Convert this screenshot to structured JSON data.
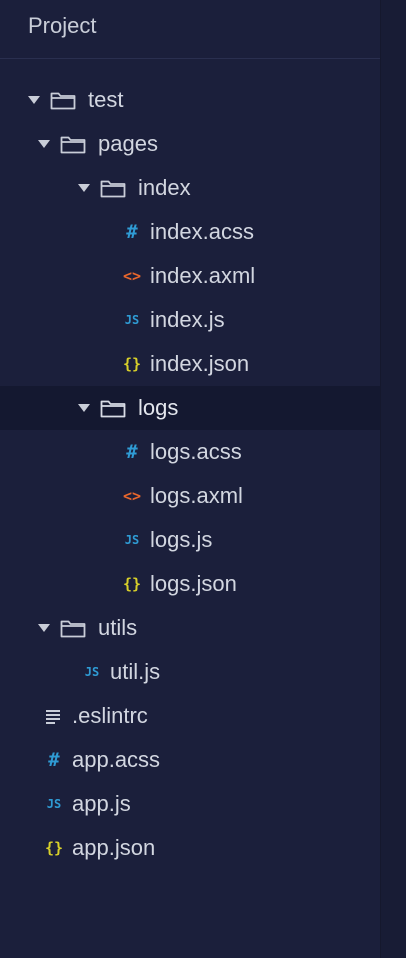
{
  "header": {
    "title": "Project"
  },
  "tree": {
    "test": {
      "label": "test",
      "pages": {
        "label": "pages",
        "index": {
          "label": "index",
          "files": [
            "index.acss",
            "index.axml",
            "index.js",
            "index.json"
          ]
        },
        "logs": {
          "label": "logs",
          "files": [
            "logs.acss",
            "logs.axml",
            "logs.js",
            "logs.json"
          ]
        }
      },
      "utils": {
        "label": "utils",
        "files": [
          "util.js"
        ]
      }
    },
    "root_files": [
      ".eslintrc",
      "app.acss",
      "app.js",
      "app.json"
    ]
  },
  "icons": {
    "hash": "#",
    "code": "<>",
    "js": "JS",
    "json": "{}"
  },
  "colors": {
    "background": "#1b1f3b",
    "selected_row": "#141830",
    "css_icon": "#2f9bd4",
    "xml_icon": "#e8662c",
    "js_icon": "#2f9bd4",
    "json_icon": "#d8d02a"
  }
}
